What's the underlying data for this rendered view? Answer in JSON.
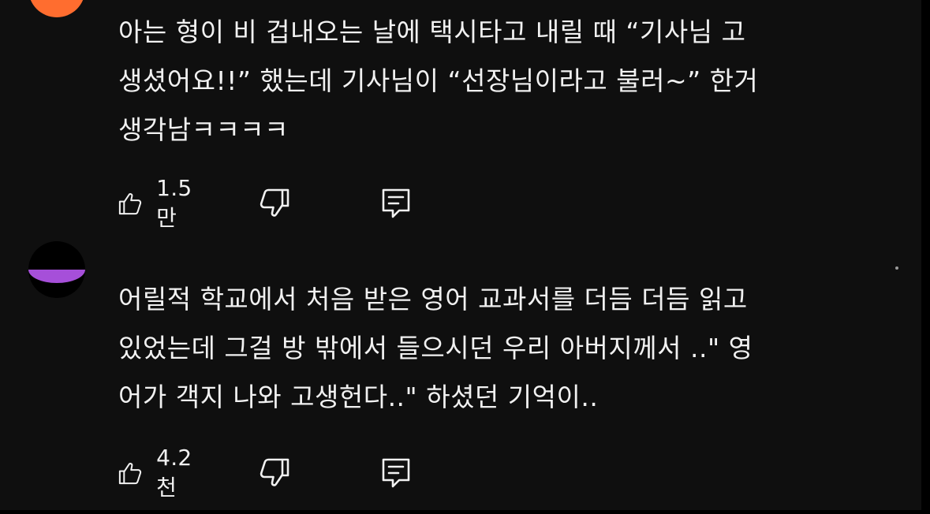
{
  "comments": [
    {
      "avatar_color": "#ff6d2f",
      "lines": [
        "아는 형이 비 겁내오는 날에 택시타고 내릴 때 “기사님 고",
        "생셨어요!!” 했는데 기사님이 “선장님이라고 불러~” 한거",
        "생각남ㅋㅋㅋㅋ"
      ],
      "like_count": "1.5만",
      "icons": {
        "like": "thumbs-up-icon",
        "dislike": "thumbs-down-icon",
        "reply": "reply-comment-icon"
      }
    },
    {
      "avatar_color": "#a64fd9",
      "lines": [
        "어릴적 학교에서 처음 받은 영어 교과서를 더듬 더듬 읽고",
        "있었는데 그걸 방 밖에서 들으시던 우리 아버지께서 ..\" 영",
        "어가 객지 나와 고생헌다..\" 하셨던 기억이.."
      ],
      "like_count": "4.2천",
      "icons": {
        "like": "thumbs-up-icon",
        "dislike": "thumbs-down-icon",
        "reply": "reply-comment-icon"
      }
    }
  ],
  "colors": {
    "background": "#0f0f0f",
    "text": "#f1f1f1"
  }
}
